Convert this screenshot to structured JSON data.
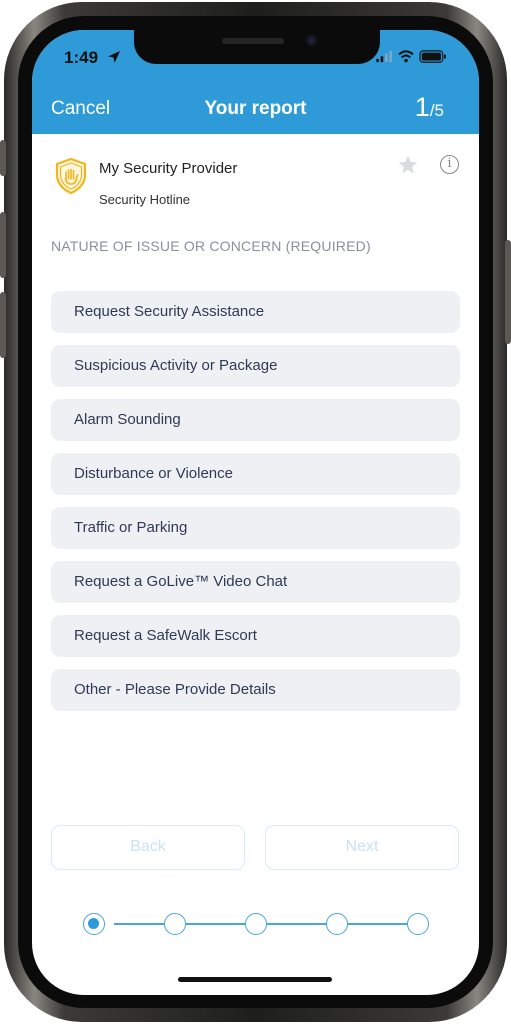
{
  "status_bar": {
    "time": "1:49"
  },
  "header": {
    "cancel_label": "Cancel",
    "title": "Your report",
    "step_current": "1",
    "step_total": "/5"
  },
  "provider": {
    "name": "My Security Provider",
    "subtitle": "Security Hotline",
    "info_glyph": "i"
  },
  "section_label": "NATURE OF ISSUE OR CONCERN (REQUIRED)",
  "options": [
    "Request Security Assistance",
    "Suspicious Activity or Package",
    "Alarm Sounding",
    "Disturbance or Violence",
    "Traffic or Parking",
    "Request a GoLive™ Video Chat",
    "Request a SafeWalk Escort",
    "Other - Please Provide Details"
  ],
  "buttons": {
    "back_label": "Back",
    "next_label": "Next"
  },
  "progress": {
    "total_steps": 5,
    "current_step": 1
  },
  "colors": {
    "header": "#2e9bd8",
    "option_bg": "#eef0f3",
    "option_text": "#2e3a56",
    "disabled_button": "#c8e3f3",
    "shield": "#f2b51c"
  },
  "icons": {
    "location": "location-arrow-icon",
    "signal": "cellular-signal-icon",
    "wifi": "wifi-icon",
    "battery": "battery-icon",
    "shield": "shield-hand-icon",
    "favorite": "star-icon",
    "info": "info-icon"
  }
}
